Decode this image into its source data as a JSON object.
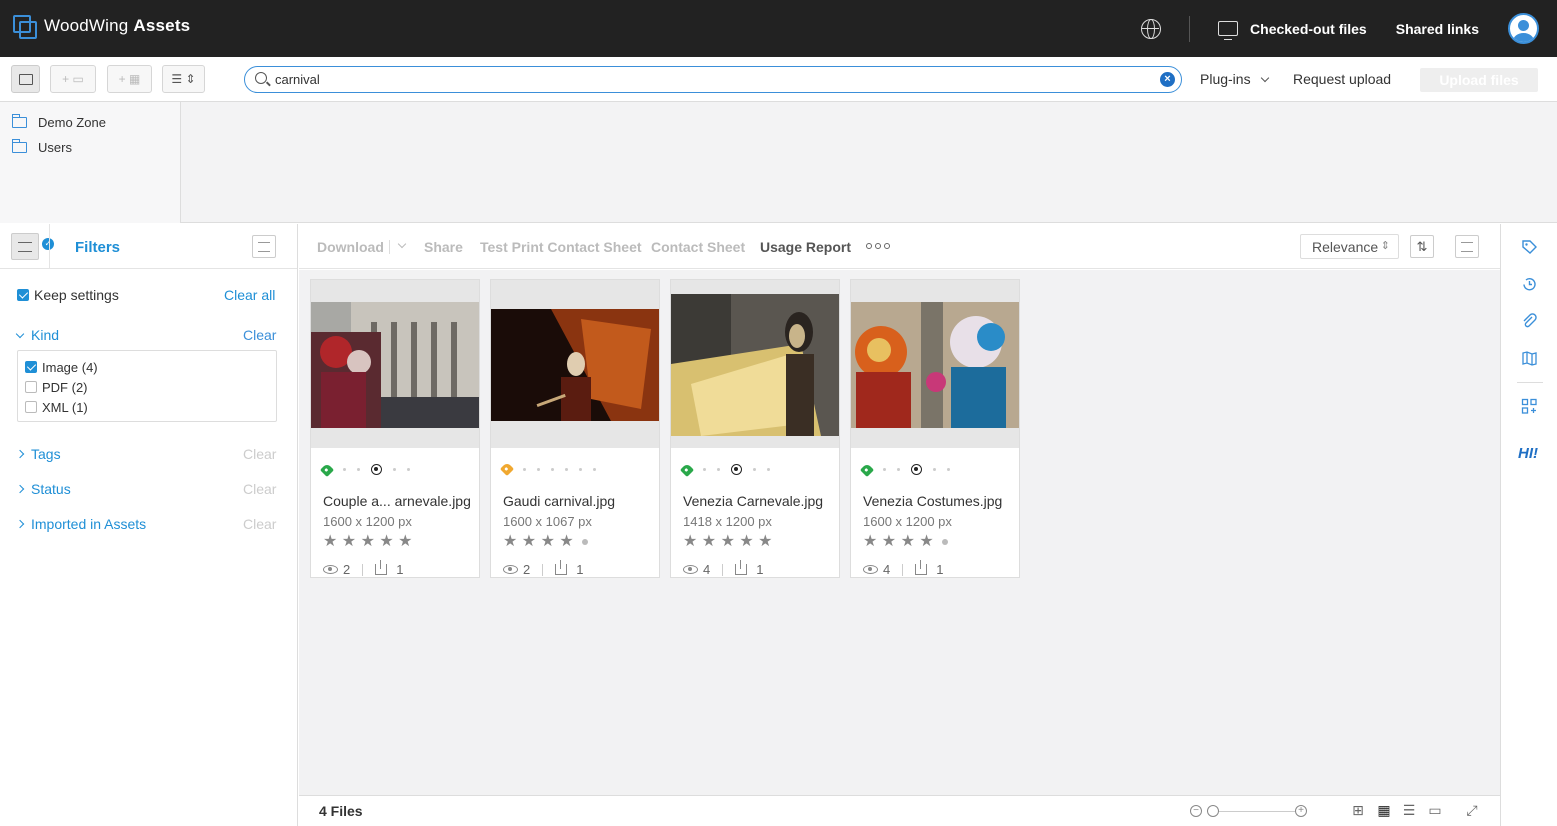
{
  "app": {
    "brand": "WoodWing",
    "product": "Assets"
  },
  "topbar": {
    "checked_out": "Checked-out files",
    "shared_links": "Shared links"
  },
  "toolbar": {
    "search_value": "carnival",
    "plugins": "Plug-ins",
    "request_upload": "Request upload",
    "upload_files": "Upload files"
  },
  "folders": [
    {
      "label": "Demo Zone"
    },
    {
      "label": "Users"
    }
  ],
  "filters": {
    "title": "Filters",
    "keep_settings": "Keep settings",
    "keep_settings_checked": true,
    "clear_all": "Clear all",
    "sections": [
      {
        "label": "Kind",
        "clear": "Clear",
        "expanded": true
      },
      {
        "label": "Tags",
        "clear": "Clear",
        "expanded": false
      },
      {
        "label": "Status",
        "clear": "Clear",
        "expanded": false
      },
      {
        "label": "Imported in Assets",
        "clear": "Clear",
        "expanded": false
      }
    ],
    "kind_options": [
      {
        "label": "Image (4)",
        "checked": true
      },
      {
        "label": "PDF (2)",
        "checked": false
      },
      {
        "label": "XML (1)",
        "checked": false
      }
    ]
  },
  "actions": {
    "download": "Download",
    "share": "Share",
    "test_print": "Test Print Contact Sheet",
    "contact_sheet": "Contact Sheet",
    "usage_report": "Usage Report",
    "sort": "Relevance"
  },
  "assets": [
    {
      "name": "Couple a... arnevale.jpg",
      "dims": "1600 x 1200 px",
      "tag_color": "#2aa84a",
      "rating": 5,
      "views": "2",
      "downloads": "1",
      "has_target": true
    },
    {
      "name": "Gaudi carnival.jpg",
      "dims": "1600 x 1067 px",
      "tag_color": "#f0a830",
      "rating": 4,
      "views": "2",
      "downloads": "1",
      "has_target": false
    },
    {
      "name": "Venezia Carnevale.jpg",
      "dims": "1418 x 1200 px",
      "tag_color": "#2aa84a",
      "rating": 5,
      "views": "4",
      "downloads": "1",
      "has_target": true
    },
    {
      "name": "Venezia Costumes.jpg",
      "dims": "1600 x 1200 px",
      "tag_color": "#2aa84a",
      "rating": 4,
      "views": "4",
      "downloads": "1",
      "has_target": true
    }
  ],
  "status": {
    "file_count": "4 Files"
  },
  "rail": {
    "hi_label": "HI!"
  },
  "colors": {
    "accent": "#1f8fd6",
    "topbar": "#222222"
  }
}
